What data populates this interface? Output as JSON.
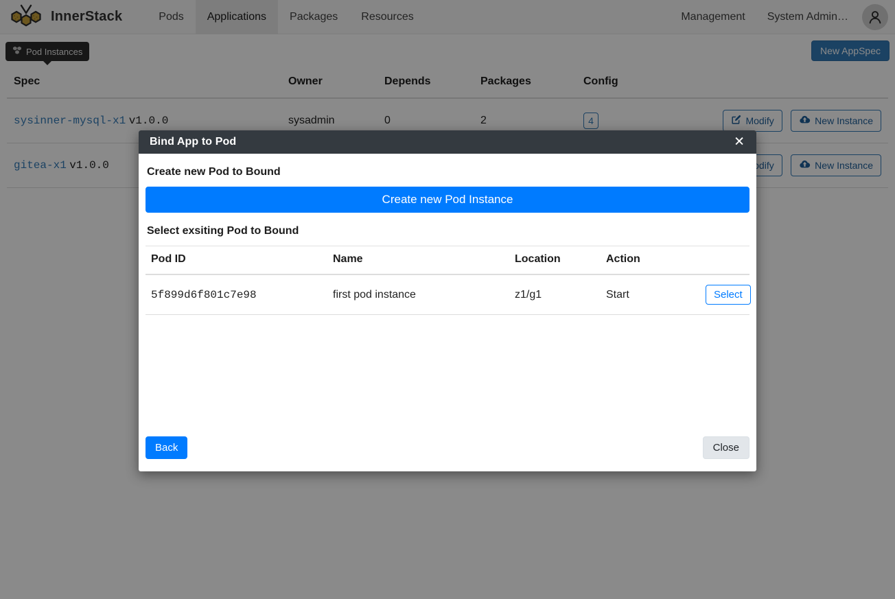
{
  "navbar": {
    "brand": "InnerStack",
    "logo_icon": "bee-honeycomb-logo",
    "links": [
      {
        "label": "Pods",
        "active": false
      },
      {
        "label": "Applications",
        "active": true
      },
      {
        "label": "Packages",
        "active": false
      },
      {
        "label": "Resources",
        "active": false
      }
    ],
    "right_links": [
      {
        "label": "Management"
      },
      {
        "label": "System Admin…"
      }
    ],
    "avatar_icon": "user-avatar-icon"
  },
  "subbar": {
    "tooltip": {
      "icon": "cubes-icon",
      "label": "Pod Instances"
    },
    "new_appspec_label": "New AppSpec"
  },
  "spec_table": {
    "columns": [
      "Spec",
      "Owner",
      "Depends",
      "Packages",
      "Config",
      ""
    ],
    "rows": [
      {
        "spec_name": "sysinner-mysql-x1",
        "spec_version": "v1.0.0",
        "owner": "sysadmin",
        "depends": "0",
        "packages": "2",
        "config": "4",
        "modify_label": "Modify",
        "new_instance_label": "New Instance"
      },
      {
        "spec_name": "gitea-x1",
        "spec_version": "v1.0.0",
        "owner": "",
        "depends": "",
        "packages": "",
        "config": "",
        "modify_label": "Modify",
        "new_instance_label": "New Instance"
      }
    ]
  },
  "modal": {
    "title": "Bind App to Pod",
    "close_icon": "close-icon",
    "create_section_title": "Create new Pod to Bound",
    "create_button_label": "Create new Pod Instance",
    "select_section_title": "Select exsiting Pod to Bound",
    "pod_table": {
      "columns": [
        "Pod ID",
        "Name",
        "Location",
        "Action",
        ""
      ],
      "rows": [
        {
          "pod_id": "5f899d6f801c7e98",
          "name": "first pod instance",
          "location": "z1/g1",
          "action": "Start",
          "select_label": "Select"
        }
      ]
    },
    "footer": {
      "back_label": "Back",
      "close_label": "Close"
    }
  },
  "colors": {
    "brand_gold": "#c8a13a",
    "primary_blue": "#007bff",
    "header_dark": "#343a40",
    "link_blue": "#337ab7",
    "navbar_bg": "#f8f8f8"
  }
}
